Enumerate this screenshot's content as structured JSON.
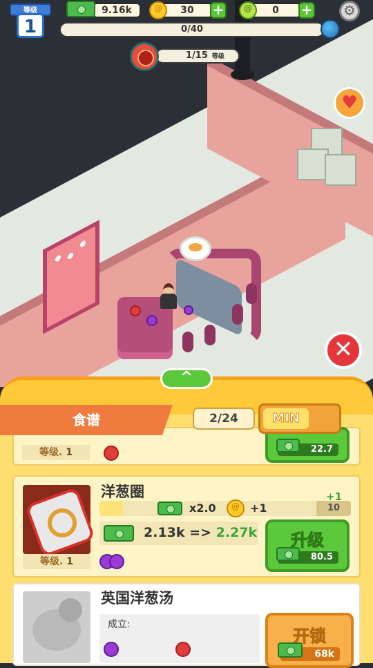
{
  "hud": {
    "level_label": "等级",
    "level": "1",
    "cash": "9.16k",
    "coins": "30",
    "gems": "0",
    "progress": "0/40",
    "dish_progress": "1/15",
    "dish_label": "等级"
  },
  "panel": {
    "collapse_glyph": "^",
    "tab_label": "食谱",
    "page_count": "2/24",
    "min_label": "MIN"
  },
  "recipes": [
    {
      "level_text": "等级.",
      "level": "1",
      "upgrade_cost": "22.7"
    },
    {
      "name": "洋葱圈",
      "multiplier": "x2.0",
      "coin_bonus": "+1",
      "max_level": "10",
      "plus_one": "+1",
      "level_text": "等级.",
      "level": "1",
      "price_current": "2.13k",
      "price_arrow": "=>",
      "price_next": "2.27k",
      "button_label": "升级",
      "upgrade_cost": "80.5",
      "progress_fraction": 0.09
    },
    {
      "name": "英国洋葱汤",
      "requirement_label": "成立:",
      "button_label": "开锁",
      "unlock_cost": "68k"
    }
  ],
  "colors": {
    "accent_green": "#5cc83c",
    "panel_yellow": "#ffc93a",
    "tab_orange": "#f07b3f",
    "close_red": "#e5373b"
  }
}
